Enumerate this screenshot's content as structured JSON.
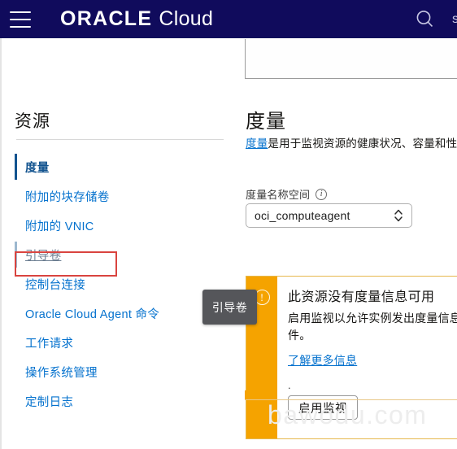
{
  "topbar": {
    "menu_icon": "hamburger-icon",
    "brand_primary": "ORACLE",
    "brand_secondary": "Cloud",
    "search_icon": "search-icon",
    "user_label": "s",
    "background_color": "#100b5c"
  },
  "sidebar": {
    "title": "资源",
    "items": [
      {
        "label": "度量",
        "state": "active"
      },
      {
        "label": "附加的块存储卷",
        "state": "default"
      },
      {
        "label": "附加的 VNIC",
        "state": "highlighted"
      },
      {
        "label": "引导卷",
        "state": "hovered"
      },
      {
        "label": "控制台连接",
        "state": "default"
      },
      {
        "label": "Oracle Cloud Agent 命令",
        "state": "default"
      },
      {
        "label": "工作请求",
        "state": "default"
      },
      {
        "label": "操作系统管理",
        "state": "default"
      },
      {
        "label": "定制日志",
        "state": "default"
      }
    ],
    "highlight_color": "#d9443f",
    "active_color": "#12538f",
    "link_color": "#0572ce"
  },
  "tooltip": {
    "text": "引导卷",
    "background_color": "#55565a"
  },
  "main": {
    "heading": "度量",
    "description_link": "度量",
    "description_rest": "是用于监视资源的健康状况、容量和性",
    "namespace_label": "度量名称空间",
    "namespace_info_icon": "info-icon",
    "namespace_value": "oci_computeagent",
    "namespace_spinner_icon": "chevron-up-down-icon",
    "alert": {
      "icon": "warning-exclamation-icon",
      "title": "此资源没有度量信息可用",
      "body": "启用监视以允许实例发出度量信息\n软件。",
      "link": "了解更多信息",
      "dot": ".",
      "button_label": "启用监视",
      "stripe_color": "#f5a300",
      "border_color": "#e6b84d"
    }
  },
  "watermark": {
    "text": "bawodu.com"
  }
}
